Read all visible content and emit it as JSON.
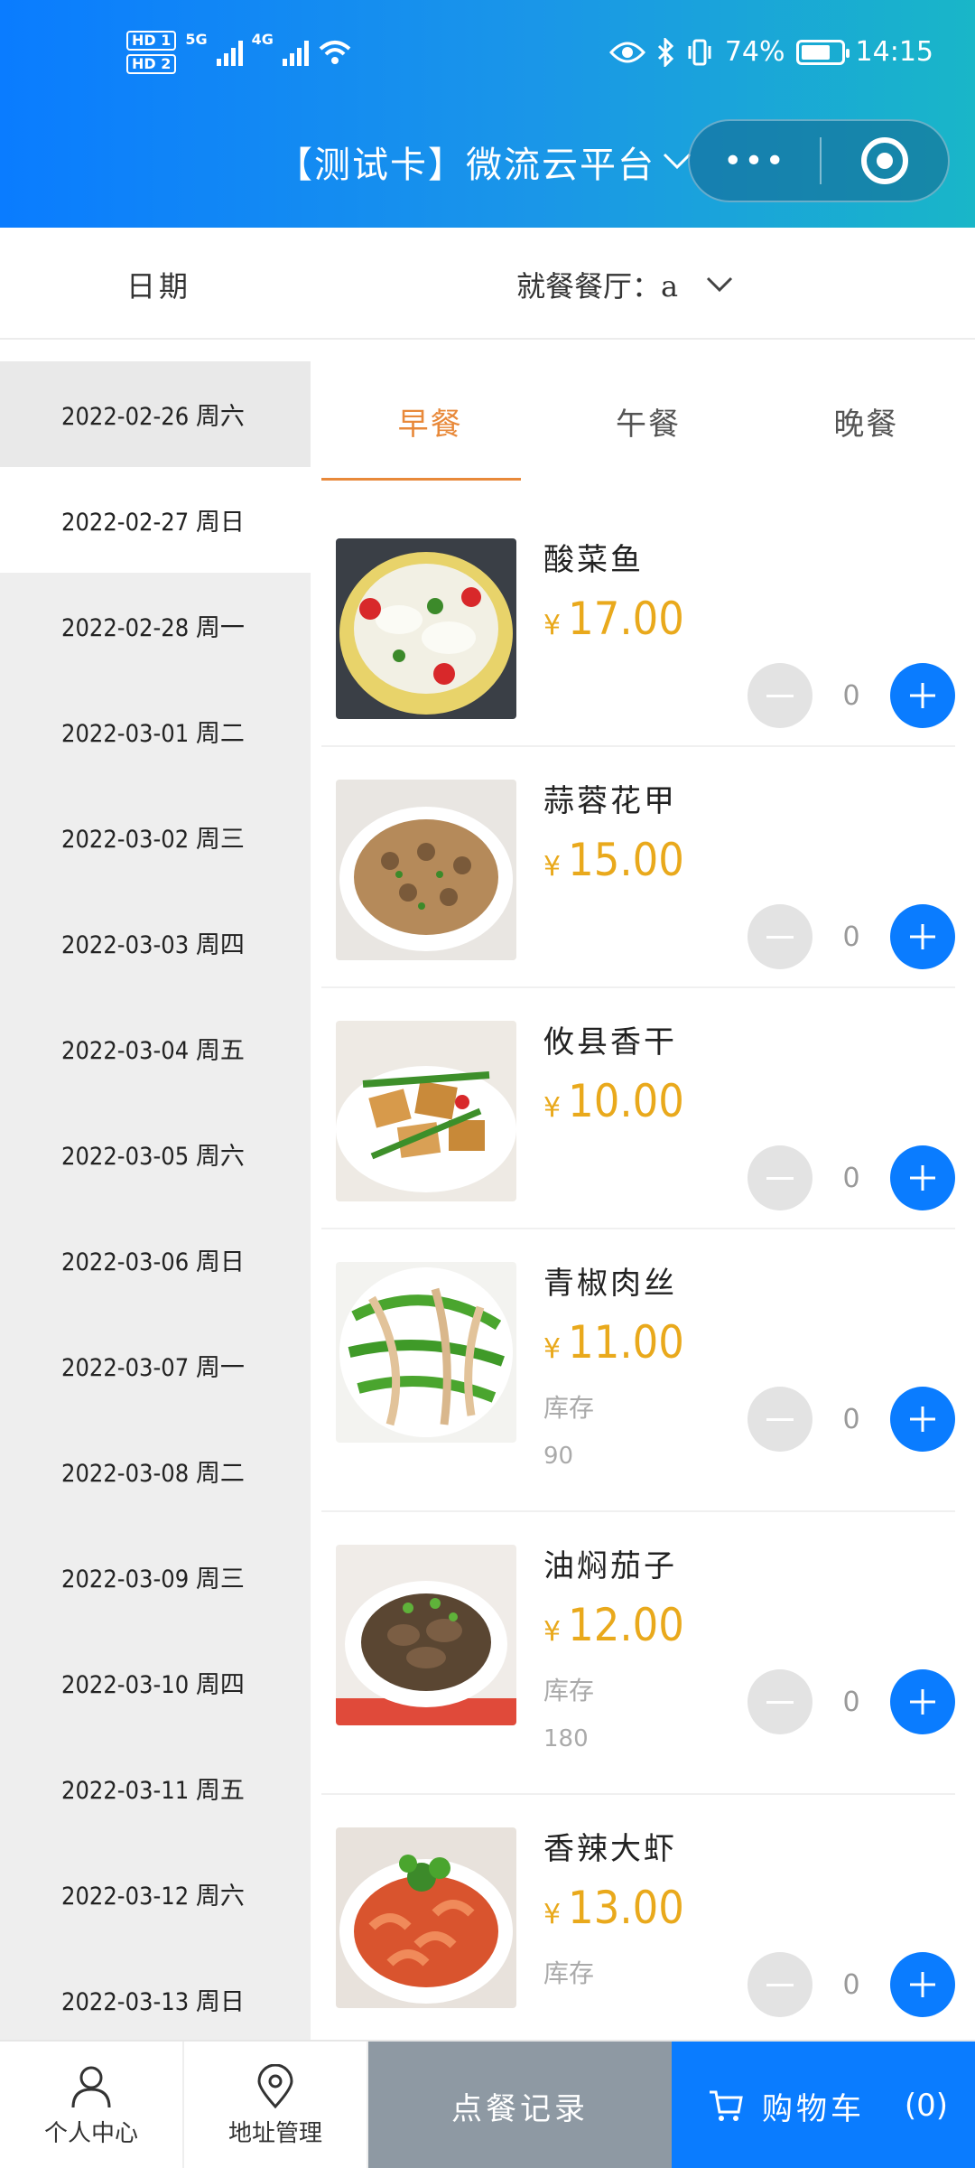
{
  "status_bar": {
    "hd1": "HD 1",
    "hd2": "HD 2",
    "net1": "5G",
    "net2": "4G",
    "battery_text": "74%",
    "battery_level": 0.74,
    "time": "14:15"
  },
  "header": {
    "title": "【测试卡】微流云平台",
    "more_label": "•••"
  },
  "filter": {
    "date_label": "日期",
    "restaurant_label": "就餐餐厅：a"
  },
  "dates": [
    "2022-02-26 周六",
    "2022-02-27 周日",
    "2022-02-28 周一",
    "2022-03-01 周二",
    "2022-03-02 周三",
    "2022-03-03 周四",
    "2022-03-04 周五",
    "2022-03-05 周六",
    "2022-03-06 周日",
    "2022-03-07 周一",
    "2022-03-08 周二",
    "2022-03-09 周三",
    "2022-03-10 周四",
    "2022-03-11 周五",
    "2022-03-12 周六",
    "2022-03-13 周日"
  ],
  "selected_date_index": 1,
  "tabs": [
    "早餐",
    "午餐",
    "晚餐"
  ],
  "active_tab": 0,
  "currency": "¥",
  "dishes": [
    {
      "name": "酸菜鱼",
      "price": "17.00",
      "qty": "0",
      "stock_label": "",
      "stock": ""
    },
    {
      "name": "蒜蓉花甲",
      "price": "15.00",
      "qty": "0",
      "stock_label": "",
      "stock": ""
    },
    {
      "name": "攸县香干",
      "price": "10.00",
      "qty": "0",
      "stock_label": "",
      "stock": ""
    },
    {
      "name": "青椒肉丝",
      "price": "11.00",
      "qty": "0",
      "stock_label": "库存",
      "stock": "90"
    },
    {
      "name": "油焖茄子",
      "price": "12.00",
      "qty": "0",
      "stock_label": "库存",
      "stock": "180"
    },
    {
      "name": "香辣大虾",
      "price": "13.00",
      "qty": "0",
      "stock_label": "库存",
      "stock": ""
    }
  ],
  "bottom_nav": {
    "profile": "个人中心",
    "address": "地址管理",
    "records": "点餐记录",
    "cart": "购物车",
    "cart_count": "(0)"
  },
  "colors": {
    "primary": "#0a7cff",
    "accent": "#e8893a",
    "price": "#e9a91c"
  }
}
